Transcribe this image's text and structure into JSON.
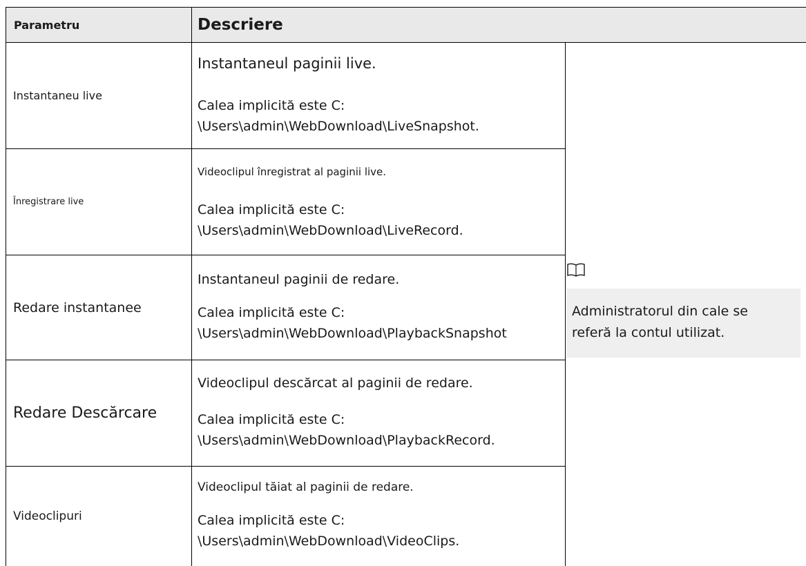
{
  "table": {
    "header": {
      "param": "Parametru",
      "desc": "Descriere"
    },
    "rows": [
      {
        "param": "Instantaneu live",
        "desc": "Instantaneul paginii live.",
        "path_line1": "Calea implicită este C:",
        "path_line2": "\\Users\\admin\\WebDownload\\LiveSnapshot."
      },
      {
        "param": "Înregistrare live",
        "desc": "Videoclipul înregistrat al paginii live.",
        "path_line1": "Calea implicită este C:",
        "path_line2": "\\Users\\admin\\WebDownload\\LiveRecord."
      },
      {
        "param": "Redare instantanee",
        "desc": "Instantaneul paginii de redare.",
        "path_line1": "Calea implicită este C:",
        "path_line2": "\\Users\\admin\\WebDownload\\PlaybackSnapshot"
      },
      {
        "param": "Redare Descărcare",
        "desc": "Videoclipul descărcat al paginii de redare.",
        "path_line1": "Calea implicită este C:",
        "path_line2": "\\Users\\admin\\WebDownload\\PlaybackRecord."
      },
      {
        "param": "Videoclipuri",
        "desc": "Videoclipul tăiat al paginii de redare.",
        "path_line1": "Calea implicită este C:",
        "path_line2": "\\Users\\admin\\WebDownload\\VideoClips."
      }
    ],
    "note": {
      "icon": "book-note-icon",
      "line1": "Administratorul din cale se",
      "line2": "referă la contul utilizat."
    }
  }
}
